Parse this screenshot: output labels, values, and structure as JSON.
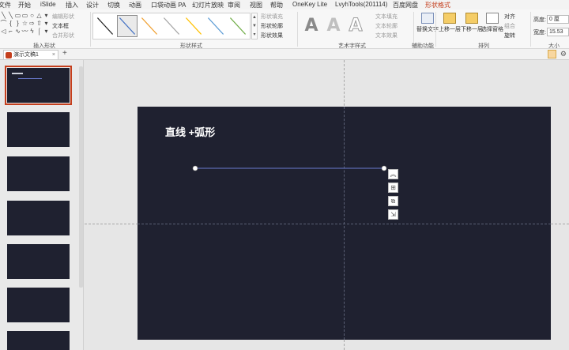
{
  "menu": {
    "tabs": [
      "文件",
      "开始",
      "iSlide",
      "插入",
      "设计",
      "切换",
      "动画",
      "口袋动画 PA",
      "幻灯片放映",
      "审阅",
      "视图",
      "帮助",
      "OneKey Lite",
      "LvyhTools(201114)",
      "百度网盘",
      "形状格式"
    ],
    "active": "形状格式"
  },
  "ribbon": {
    "insert_shapes": {
      "label": "插入形状",
      "edit_shape": "编辑形状",
      "text_box": "文本框",
      "merge_shapes": "合并形状"
    },
    "shape_styles": {
      "label": "形状样式",
      "fill": "形状填充",
      "outline": "形状轮廓",
      "effects": "形状效果"
    },
    "wordart": {
      "label": "艺术字样式",
      "glyph": "A",
      "text_fill": "文本填充",
      "text_outline": "文本轮廓",
      "text_effects": "文本效果"
    },
    "accessibility": {
      "label": "辅助功能",
      "alt_text": "替换文字"
    },
    "arrange": {
      "label": "排列",
      "bring_forward": "上移一层",
      "send_backward": "下移一层",
      "selection_pane": "选择窗格",
      "align": "对齐",
      "group": "组合",
      "rotate": "旋转"
    },
    "size": {
      "label": "大小",
      "height_label": "高度:",
      "height_value": "0 厘",
      "width_label": "宽度:",
      "width_value": "15.53"
    }
  },
  "doc": {
    "tab_title": "演示文稿1",
    "close": "×",
    "add": "+"
  },
  "thumbnails": {
    "count": 7,
    "selected_index": 0
  },
  "slide": {
    "title": "直线 +弧形",
    "line_color": "#6b7bd0",
    "background": "#1f2130"
  },
  "float_tools": [
    "layout-options-icon",
    "add-icon",
    "copy-format-icon",
    "link-icon"
  ]
}
